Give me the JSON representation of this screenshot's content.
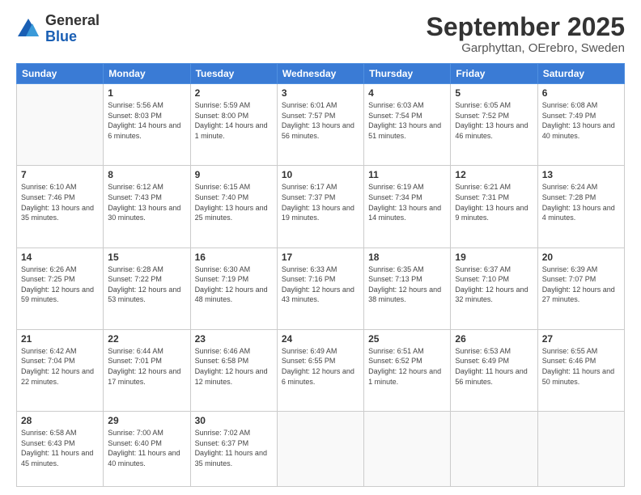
{
  "header": {
    "logo": {
      "general": "General",
      "blue": "Blue"
    },
    "title": "September 2025",
    "location": "Garphyttan, OErebro, Sweden"
  },
  "days_of_week": [
    "Sunday",
    "Monday",
    "Tuesday",
    "Wednesday",
    "Thursday",
    "Friday",
    "Saturday"
  ],
  "weeks": [
    [
      {
        "day": "",
        "sunrise": "",
        "sunset": "",
        "daylight": ""
      },
      {
        "day": "1",
        "sunrise": "Sunrise: 5:56 AM",
        "sunset": "Sunset: 8:03 PM",
        "daylight": "Daylight: 14 hours and 6 minutes."
      },
      {
        "day": "2",
        "sunrise": "Sunrise: 5:59 AM",
        "sunset": "Sunset: 8:00 PM",
        "daylight": "Daylight: 14 hours and 1 minute."
      },
      {
        "day": "3",
        "sunrise": "Sunrise: 6:01 AM",
        "sunset": "Sunset: 7:57 PM",
        "daylight": "Daylight: 13 hours and 56 minutes."
      },
      {
        "day": "4",
        "sunrise": "Sunrise: 6:03 AM",
        "sunset": "Sunset: 7:54 PM",
        "daylight": "Daylight: 13 hours and 51 minutes."
      },
      {
        "day": "5",
        "sunrise": "Sunrise: 6:05 AM",
        "sunset": "Sunset: 7:52 PM",
        "daylight": "Daylight: 13 hours and 46 minutes."
      },
      {
        "day": "6",
        "sunrise": "Sunrise: 6:08 AM",
        "sunset": "Sunset: 7:49 PM",
        "daylight": "Daylight: 13 hours and 40 minutes."
      }
    ],
    [
      {
        "day": "7",
        "sunrise": "Sunrise: 6:10 AM",
        "sunset": "Sunset: 7:46 PM",
        "daylight": "Daylight: 13 hours and 35 minutes."
      },
      {
        "day": "8",
        "sunrise": "Sunrise: 6:12 AM",
        "sunset": "Sunset: 7:43 PM",
        "daylight": "Daylight: 13 hours and 30 minutes."
      },
      {
        "day": "9",
        "sunrise": "Sunrise: 6:15 AM",
        "sunset": "Sunset: 7:40 PM",
        "daylight": "Daylight: 13 hours and 25 minutes."
      },
      {
        "day": "10",
        "sunrise": "Sunrise: 6:17 AM",
        "sunset": "Sunset: 7:37 PM",
        "daylight": "Daylight: 13 hours and 19 minutes."
      },
      {
        "day": "11",
        "sunrise": "Sunrise: 6:19 AM",
        "sunset": "Sunset: 7:34 PM",
        "daylight": "Daylight: 13 hours and 14 minutes."
      },
      {
        "day": "12",
        "sunrise": "Sunrise: 6:21 AM",
        "sunset": "Sunset: 7:31 PM",
        "daylight": "Daylight: 13 hours and 9 minutes."
      },
      {
        "day": "13",
        "sunrise": "Sunrise: 6:24 AM",
        "sunset": "Sunset: 7:28 PM",
        "daylight": "Daylight: 13 hours and 4 minutes."
      }
    ],
    [
      {
        "day": "14",
        "sunrise": "Sunrise: 6:26 AM",
        "sunset": "Sunset: 7:25 PM",
        "daylight": "Daylight: 12 hours and 59 minutes."
      },
      {
        "day": "15",
        "sunrise": "Sunrise: 6:28 AM",
        "sunset": "Sunset: 7:22 PM",
        "daylight": "Daylight: 12 hours and 53 minutes."
      },
      {
        "day": "16",
        "sunrise": "Sunrise: 6:30 AM",
        "sunset": "Sunset: 7:19 PM",
        "daylight": "Daylight: 12 hours and 48 minutes."
      },
      {
        "day": "17",
        "sunrise": "Sunrise: 6:33 AM",
        "sunset": "Sunset: 7:16 PM",
        "daylight": "Daylight: 12 hours and 43 minutes."
      },
      {
        "day": "18",
        "sunrise": "Sunrise: 6:35 AM",
        "sunset": "Sunset: 7:13 PM",
        "daylight": "Daylight: 12 hours and 38 minutes."
      },
      {
        "day": "19",
        "sunrise": "Sunrise: 6:37 AM",
        "sunset": "Sunset: 7:10 PM",
        "daylight": "Daylight: 12 hours and 32 minutes."
      },
      {
        "day": "20",
        "sunrise": "Sunrise: 6:39 AM",
        "sunset": "Sunset: 7:07 PM",
        "daylight": "Daylight: 12 hours and 27 minutes."
      }
    ],
    [
      {
        "day": "21",
        "sunrise": "Sunrise: 6:42 AM",
        "sunset": "Sunset: 7:04 PM",
        "daylight": "Daylight: 12 hours and 22 minutes."
      },
      {
        "day": "22",
        "sunrise": "Sunrise: 6:44 AM",
        "sunset": "Sunset: 7:01 PM",
        "daylight": "Daylight: 12 hours and 17 minutes."
      },
      {
        "day": "23",
        "sunrise": "Sunrise: 6:46 AM",
        "sunset": "Sunset: 6:58 PM",
        "daylight": "Daylight: 12 hours and 12 minutes."
      },
      {
        "day": "24",
        "sunrise": "Sunrise: 6:49 AM",
        "sunset": "Sunset: 6:55 PM",
        "daylight": "Daylight: 12 hours and 6 minutes."
      },
      {
        "day": "25",
        "sunrise": "Sunrise: 6:51 AM",
        "sunset": "Sunset: 6:52 PM",
        "daylight": "Daylight: 12 hours and 1 minute."
      },
      {
        "day": "26",
        "sunrise": "Sunrise: 6:53 AM",
        "sunset": "Sunset: 6:49 PM",
        "daylight": "Daylight: 11 hours and 56 minutes."
      },
      {
        "day": "27",
        "sunrise": "Sunrise: 6:55 AM",
        "sunset": "Sunset: 6:46 PM",
        "daylight": "Daylight: 11 hours and 50 minutes."
      }
    ],
    [
      {
        "day": "28",
        "sunrise": "Sunrise: 6:58 AM",
        "sunset": "Sunset: 6:43 PM",
        "daylight": "Daylight: 11 hours and 45 minutes."
      },
      {
        "day": "29",
        "sunrise": "Sunrise: 7:00 AM",
        "sunset": "Sunset: 6:40 PM",
        "daylight": "Daylight: 11 hours and 40 minutes."
      },
      {
        "day": "30",
        "sunrise": "Sunrise: 7:02 AM",
        "sunset": "Sunset: 6:37 PM",
        "daylight": "Daylight: 11 hours and 35 minutes."
      },
      {
        "day": "",
        "sunrise": "",
        "sunset": "",
        "daylight": ""
      },
      {
        "day": "",
        "sunrise": "",
        "sunset": "",
        "daylight": ""
      },
      {
        "day": "",
        "sunrise": "",
        "sunset": "",
        "daylight": ""
      },
      {
        "day": "",
        "sunrise": "",
        "sunset": "",
        "daylight": ""
      }
    ]
  ]
}
